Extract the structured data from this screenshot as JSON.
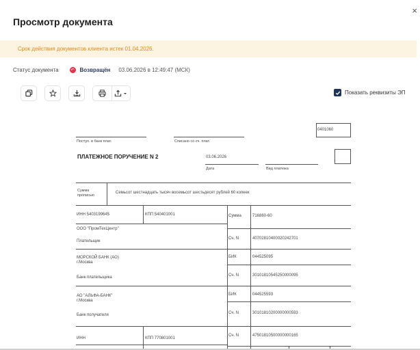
{
  "modal": {
    "title": "Просмотр документа",
    "close_icon": "×"
  },
  "alert": {
    "text": "Срок действия документов клиента истек 01.04.2026."
  },
  "status": {
    "label": "Статус документа",
    "value": "Возвращён",
    "datetime": "03.06.2026 в 12:49:47 (МСК)",
    "color": "#e0344c"
  },
  "toolbar": {
    "icons": [
      "copy-icon",
      "star-icon",
      "download-icon",
      "print-icon",
      "export-icon",
      "chevron-down-icon"
    ],
    "show_ep_label": "Показать реквизиты ЭП",
    "show_ep_checked": true
  },
  "document": {
    "form_code": "0401060",
    "received_label": "Поступ. в банк плат.",
    "debited_label": "Списано со сч. плат.",
    "title": "ПЛАТЕЖНОЕ ПОРУЧЕНИЕ N 2",
    "date_value": "03.06.2026",
    "date_label": "Дата",
    "payment_type_label": "Вид платежа",
    "amount_words_label_1": "Сумма",
    "amount_words_label_2": "прописью",
    "amount_words": "Семьсот шестнадцать тысяч восемьсот шестьдесят рублей 60 копеек",
    "payer_inn": "ИНН 5403199645",
    "payer_kpp": "КПП 540401001",
    "sum_label": "Сумма",
    "sum_value": "716860-60",
    "payer_name": "ООО \"ПромТехЦентр\"",
    "payer_account_label": "Сч. N",
    "payer_account": "40702810400020242701",
    "payer_label": "Плательщик",
    "payer_bank_name": "МОРСКОЙ БАНК (АО)",
    "payer_bank_city": "г.Москва",
    "bik_label": "БИК",
    "payer_bik": "044525095",
    "payer_bank_account_label": "Сч. N",
    "payer_bank_account": "30101810545250000095",
    "payer_bank_label": "Банк плательщика",
    "payee_bank_name": "АО \"АЛЬФА-БАНК\"",
    "payee_bank_city": "г.Москва",
    "payee_bik_label": "БИК",
    "payee_bik": "044525593",
    "payee_bank_account_label": "Сч. N",
    "payee_bank_account": "30101810200000000593",
    "payee_bank_label": "Банк получателя",
    "payee_inn_label": "ИНН",
    "payee_kpp": "КПП 770801001",
    "payee_account_label": "Сч. N",
    "payee_account": "47501810500000000165"
  }
}
